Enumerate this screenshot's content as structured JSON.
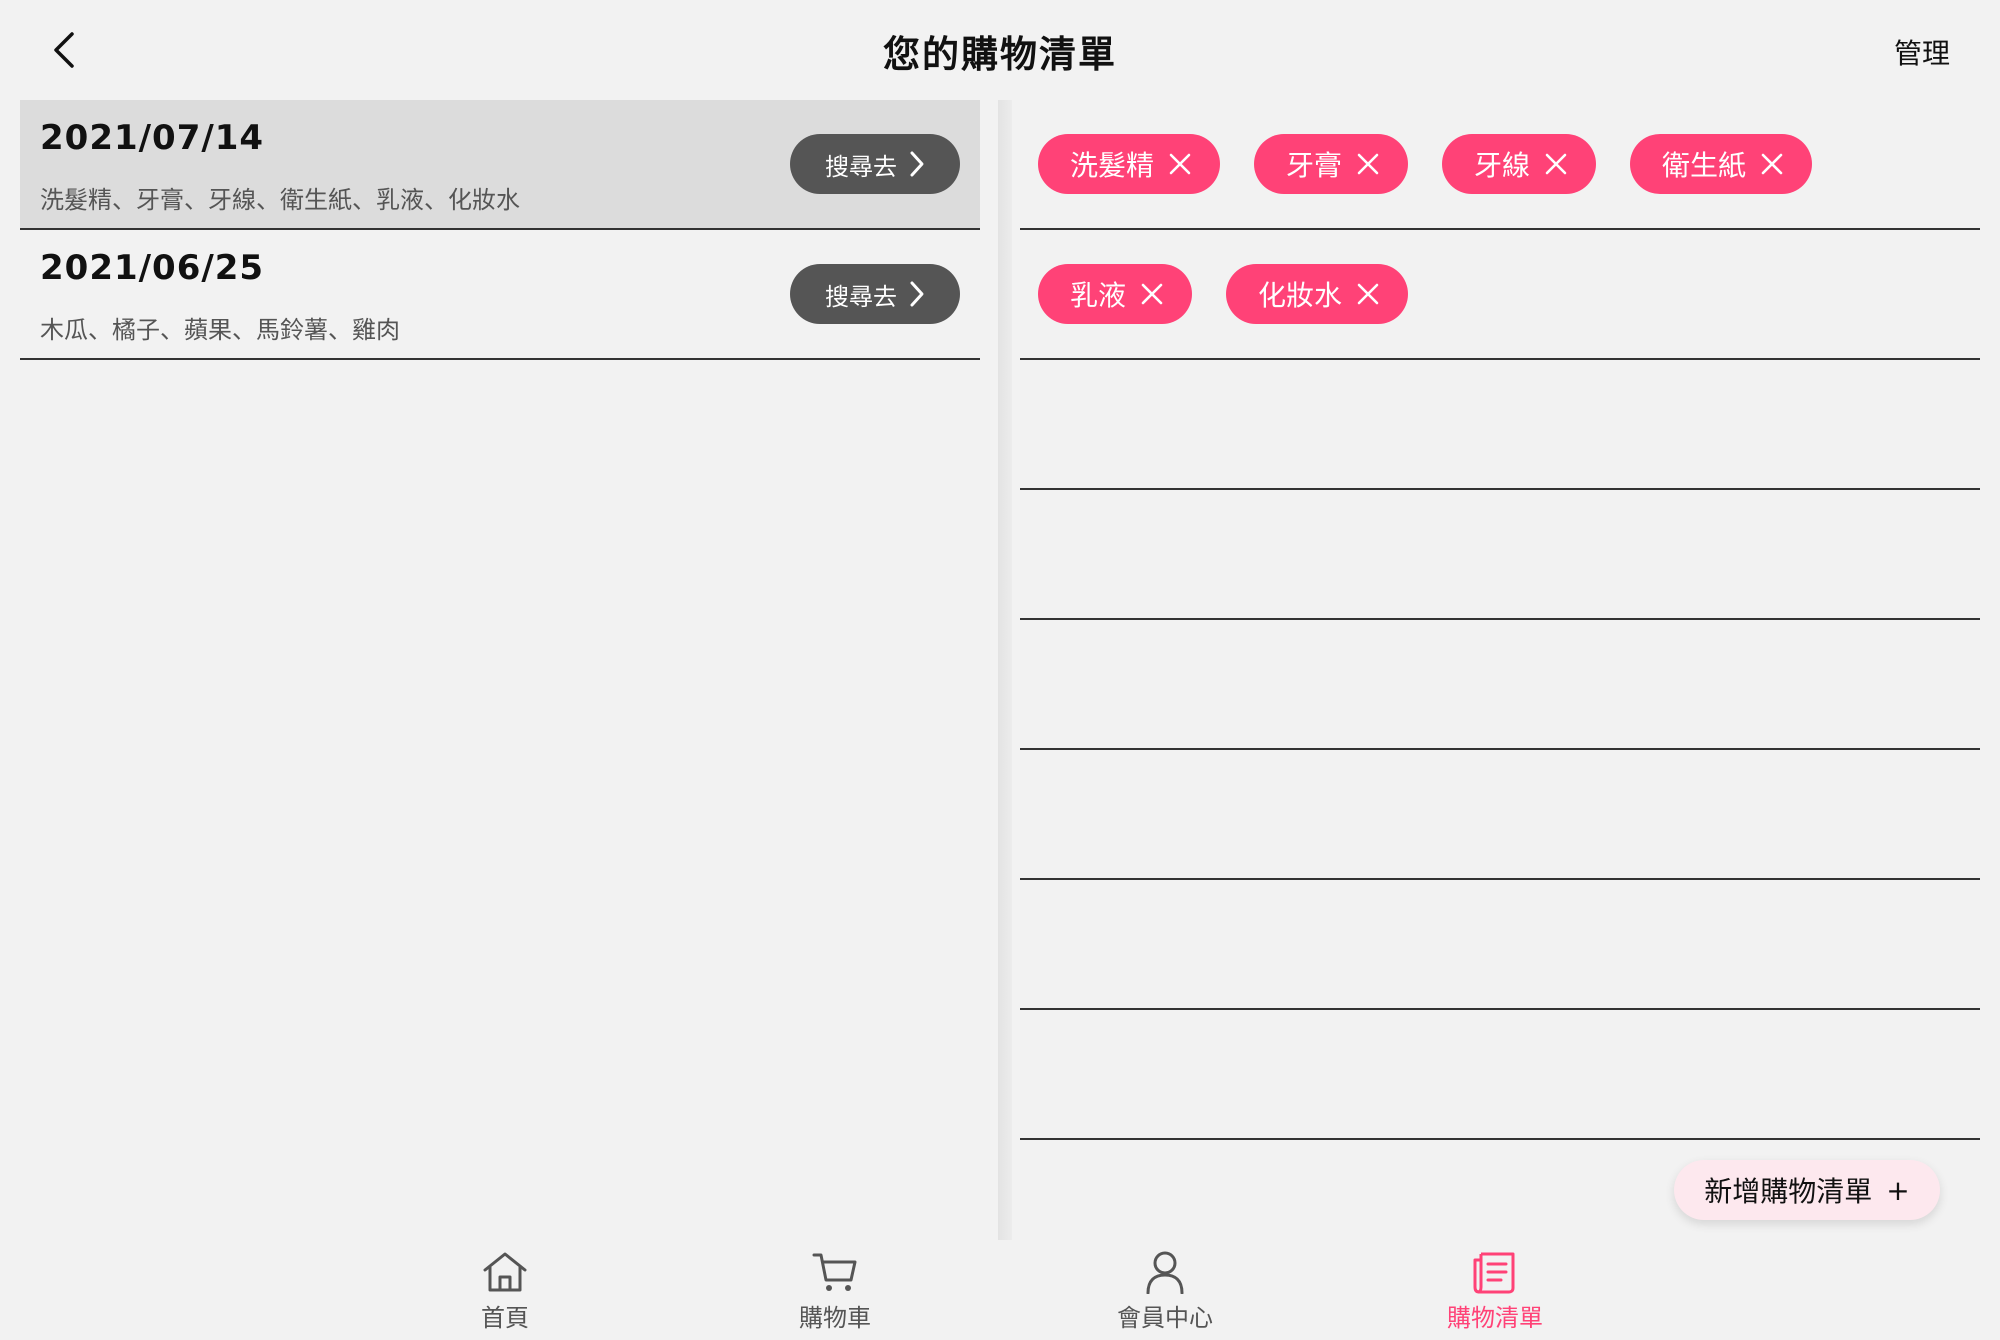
{
  "header": {
    "title": "您的購物清單",
    "manage_label": "管理"
  },
  "lists": [
    {
      "date": "2021/07/14",
      "items_text": "洗髮精、牙膏、牙線、衛生紙、乳液、化妝水",
      "search_label": "搜尋去",
      "selected": true
    },
    {
      "date": "2021/06/25",
      "items_text": "木瓜、橘子、蘋果、馬鈴薯、雞肉",
      "search_label": "搜尋去",
      "selected": false
    }
  ],
  "tags": {
    "row1": [
      "洗髮精",
      "牙膏",
      "牙線",
      "衛生紙"
    ],
    "row2": [
      "乳液",
      "化妝水"
    ]
  },
  "add_button": {
    "label": "新增購物清單",
    "icon": "+"
  },
  "bottom_nav": {
    "items": [
      {
        "label": "首頁",
        "icon": "home-icon",
        "active": false
      },
      {
        "label": "購物車",
        "icon": "cart-icon",
        "active": false
      },
      {
        "label": "會員中心",
        "icon": "user-icon",
        "active": false
      },
      {
        "label": "購物清單",
        "icon": "list-icon",
        "active": true
      }
    ]
  },
  "colors": {
    "accent": "#ff4277",
    "button_dark": "#555555",
    "selected_row": "#dcdcdc",
    "background": "#f2f2f2"
  }
}
